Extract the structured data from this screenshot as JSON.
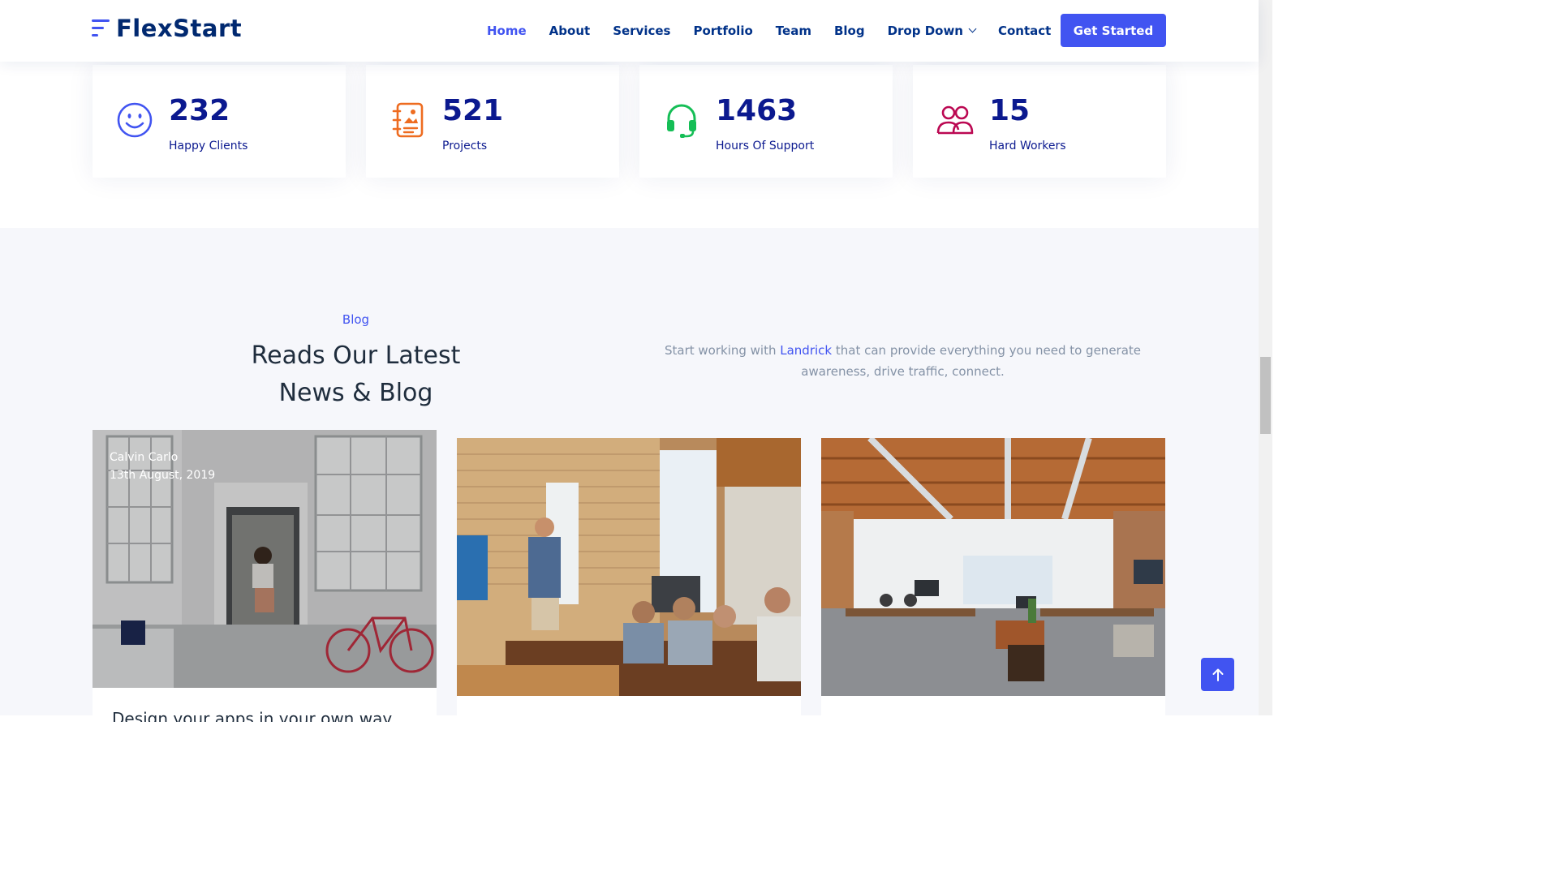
{
  "brand": {
    "name": "FlexStart",
    "accent": "#4154f1"
  },
  "nav": {
    "items": [
      {
        "label": "Home",
        "active": true
      },
      {
        "label": "About"
      },
      {
        "label": "Services"
      },
      {
        "label": "Portfolio"
      },
      {
        "label": "Team"
      },
      {
        "label": "Blog"
      },
      {
        "label": "Drop Down"
      },
      {
        "label": "Contact"
      }
    ],
    "cta": "Get Started"
  },
  "counters": [
    {
      "value": "232",
      "label": "Happy Clients",
      "icon": "emoji-smile-icon",
      "color": "#4154f1"
    },
    {
      "value": "521",
      "label": "Projects",
      "icon": "journal-richtext-icon",
      "color": "#ee6c20"
    },
    {
      "value": "1463",
      "label": "Hours Of Support",
      "icon": "headset-icon",
      "color": "#15be56"
    },
    {
      "value": "15",
      "label": "Hard Workers",
      "icon": "people-icon",
      "color": "#bb0852"
    }
  ],
  "blog": {
    "tag": "Blog",
    "title_line1": "Reads Our Latest",
    "title_line2": "News & Blog",
    "desc_before": "Start working with ",
    "desc_highlight": "Landrick",
    "desc_after": " that can provide everything you need to generate awareness, drive traffic, connect.",
    "posts": [
      {
        "author": "Calvin Carlo",
        "date": "13th August, 2019",
        "title": "Design your apps in your own way"
      },
      {
        "author": "",
        "date": "",
        "title": ""
      },
      {
        "author": "",
        "date": "",
        "title": ""
      }
    ]
  },
  "icons": {
    "back_to_top": "arrow-up-icon",
    "dropdown": "chevron-down-icon"
  }
}
